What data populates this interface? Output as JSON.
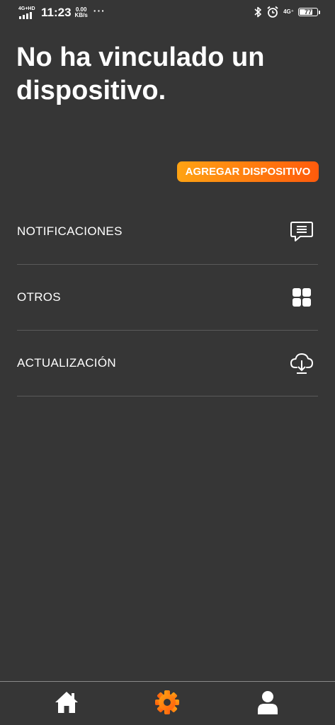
{
  "status_bar": {
    "network_label": "4G+HD",
    "time": "11:23",
    "speed_value": "0.00",
    "speed_unit": "KB/s",
    "more": "···",
    "mobile_data": "4G⁺",
    "battery": "77",
    "battery_level": 0.77
  },
  "main": {
    "title": "No ha vinculado un dispositivo.",
    "add_button": "AGREGAR DISPOSITIVO"
  },
  "menu": [
    {
      "label": "NOTIFICACIONES",
      "icon": "chat-message-icon"
    },
    {
      "label": "OTROS",
      "icon": "grid-apps-icon"
    },
    {
      "label": "ACTUALIZACIÓN",
      "icon": "cloud-download-icon"
    }
  ],
  "bottom_nav": [
    {
      "icon": "home-icon",
      "active": false
    },
    {
      "icon": "gear-icon",
      "active": true
    },
    {
      "icon": "user-icon",
      "active": false
    }
  ],
  "colors": {
    "background": "#363636",
    "accent_start": "#ffa313",
    "accent_end": "#ff5b0c",
    "text": "#ffffff"
  }
}
